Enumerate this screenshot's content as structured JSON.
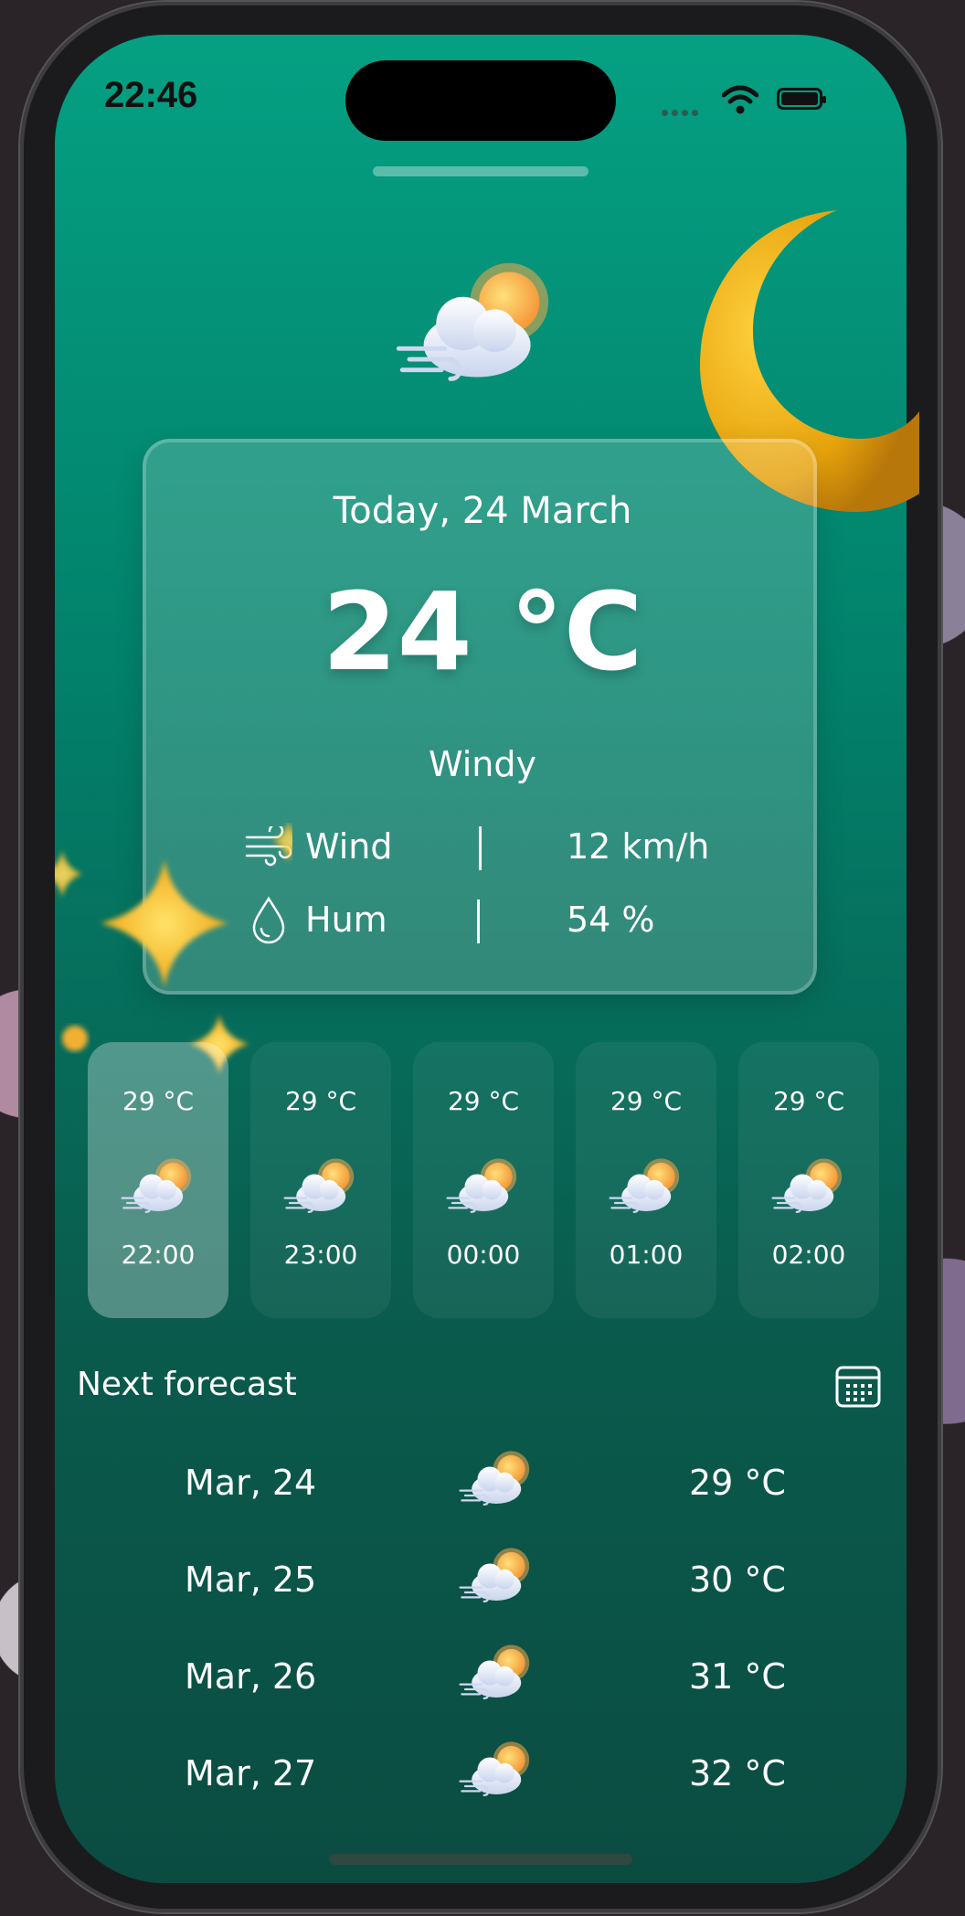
{
  "status_bar": {
    "time": "22:46"
  },
  "today": {
    "date": "Today, 24 March",
    "temperature": "24 °C",
    "condition": "Windy",
    "wind_label": "Wind",
    "wind_value": "12 km/h",
    "humidity_label": "Hum",
    "humidity_value": "54 %"
  },
  "hourly": [
    {
      "temp": "29 °C",
      "time": "22:00",
      "icon": "windy-cloud-sun-icon",
      "active": true
    },
    {
      "temp": "29 °C",
      "time": "23:00",
      "icon": "windy-cloud-sun-icon",
      "active": false
    },
    {
      "temp": "29 °C",
      "time": "00:00",
      "icon": "windy-cloud-sun-icon",
      "active": false
    },
    {
      "temp": "29 °C",
      "time": "01:00",
      "icon": "windy-cloud-sun-icon",
      "active": false
    },
    {
      "temp": "29 °C",
      "time": "02:00",
      "icon": "windy-cloud-sun-icon",
      "active": false
    }
  ],
  "forecast": {
    "title": "Next forecast",
    "items": [
      {
        "date": "Mar, 24",
        "temp": "29 °C",
        "icon": "windy-cloud-sun-icon"
      },
      {
        "date": "Mar, 25",
        "temp": "30 °C",
        "icon": "windy-cloud-sun-icon"
      },
      {
        "date": "Mar, 26",
        "temp": "31 °C",
        "icon": "windy-cloud-sun-icon"
      },
      {
        "date": "Mar, 27",
        "temp": "32 °C",
        "icon": "windy-cloud-sun-icon"
      }
    ]
  },
  "colors": {
    "accent": "#05a083",
    "bottom": "#0b4c41"
  }
}
